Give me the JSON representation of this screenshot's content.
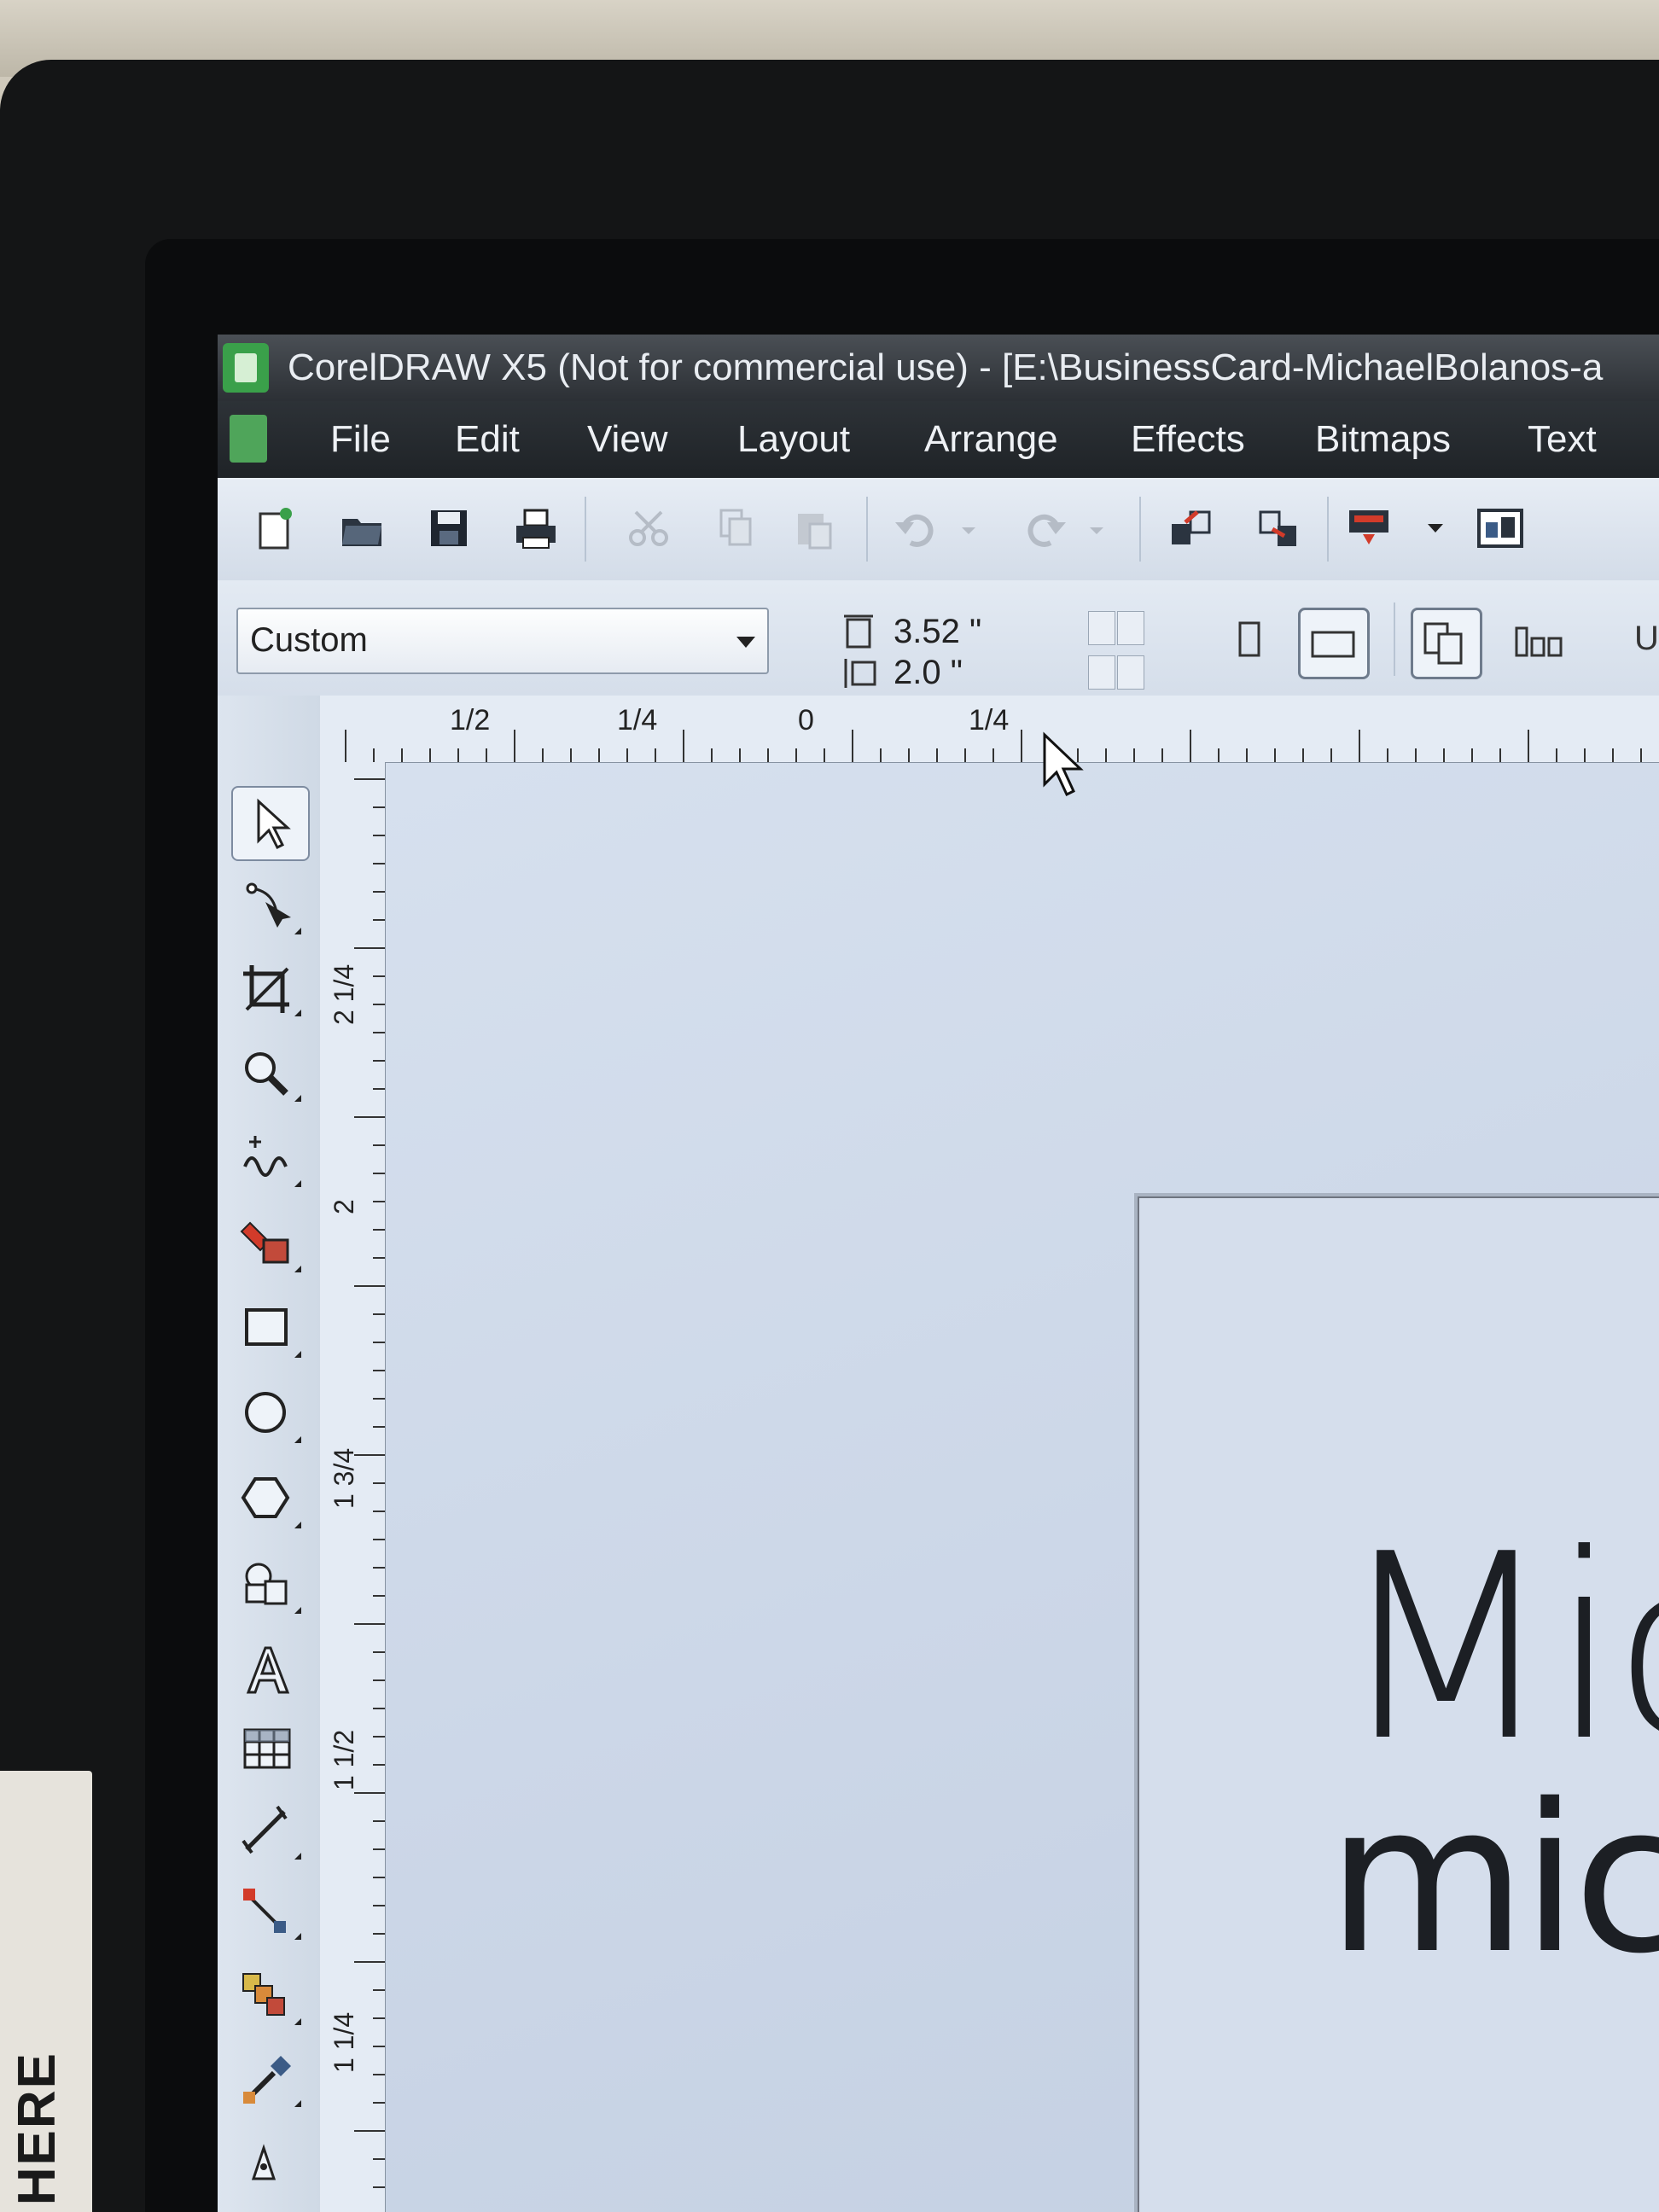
{
  "window": {
    "title": "CorelDRAW X5 (Not for commercial use) - [E:\\BusinessCard-MichaelBolanos-a"
  },
  "menu": {
    "items": [
      {
        "label": "File"
      },
      {
        "label": "Edit"
      },
      {
        "label": "View"
      },
      {
        "label": "Layout"
      },
      {
        "label": "Arrange"
      },
      {
        "label": "Effects"
      },
      {
        "label": "Bitmaps"
      },
      {
        "label": "Text"
      }
    ]
  },
  "toolbar": {
    "buttons": [
      "new-document-icon",
      "open-icon",
      "save-icon",
      "print-icon",
      "cut-icon",
      "copy-icon",
      "paste-icon",
      "undo-icon",
      "redo-icon",
      "import-icon",
      "export-icon",
      "application-launcher-icon",
      "welcome-screen-icon"
    ]
  },
  "property_bar": {
    "page_preset": "Custom",
    "width": "3.52 \"",
    "height": "2.0 \"",
    "units_partial": "U"
  },
  "rulers": {
    "horizontal": [
      "1/2",
      "1/4",
      "0",
      "1/4"
    ],
    "vertical": [
      "2 1/4",
      "2",
      "1 3/4",
      "1 1/2",
      "1 1/4"
    ]
  },
  "toolbox": {
    "tools": [
      "pick-tool-icon",
      "shape-tool-icon",
      "crop-tool-icon",
      "zoom-tool-icon",
      "freehand-tool-icon",
      "smart-fill-icon",
      "rectangle-tool-icon",
      "ellipse-tool-icon",
      "polygon-tool-icon",
      "basic-shapes-icon",
      "text-tool-icon",
      "table-tool-icon",
      "dimension-tool-icon",
      "connector-tool-icon",
      "blend-tool-icon",
      "eyedropper-tool-icon",
      "outline-pen-icon"
    ]
  },
  "canvas": {
    "name_text": "Mic",
    "email_text": "mich"
  },
  "monitor_sticker": {
    "text": "HERE"
  },
  "colors": {
    "title_bar": "#2c3035",
    "canvas": "#cfdaea",
    "app_icon": "#3aa04a"
  }
}
